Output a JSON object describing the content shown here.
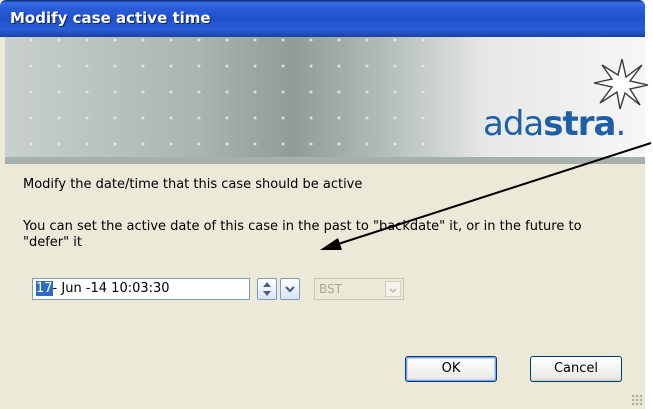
{
  "window": {
    "title": "Modify case active time"
  },
  "banner": {
    "logo_prefix": "ada",
    "logo_suffix": "stra",
    "logo_dot": ".",
    "logo_color": "#1f5fa8"
  },
  "content": {
    "instruction": "Modify the date/time that this case should be active",
    "explanation": "You can set the active date of this case in the past to \"backdate\" it, or in the future to \"defer\" it"
  },
  "datetime": {
    "day": "17",
    "rest": "- Jun -14 10:03:30"
  },
  "timezone": {
    "value": "BST"
  },
  "buttons": {
    "ok_label": "OK",
    "cancel_label": "Cancel"
  },
  "colors": {
    "titlebar": "#2a5ed8",
    "dialog_bg": "#ece9d8",
    "selection": "#316ac5",
    "annotation_arrow": "#000000"
  },
  "icons": [
    "adastra-star-icon",
    "spin-up-down-icon",
    "chevron-down-icon",
    "resize-grip-icon"
  ]
}
